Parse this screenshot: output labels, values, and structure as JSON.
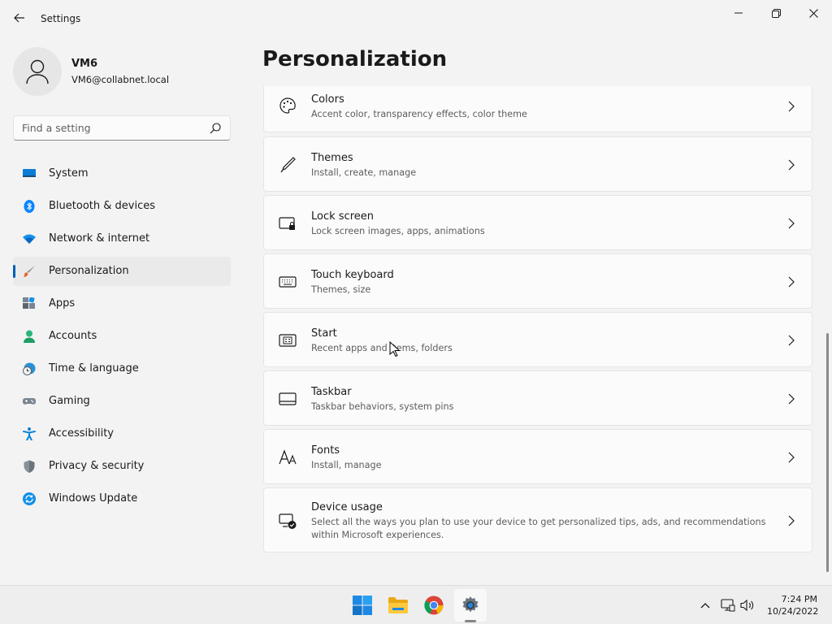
{
  "window": {
    "title": "Settings"
  },
  "profile": {
    "name": "VM6",
    "email": "VM6@collabnet.local"
  },
  "search": {
    "placeholder": "Find a setting"
  },
  "nav": {
    "items": [
      {
        "label": "System",
        "icon": "system-icon"
      },
      {
        "label": "Bluetooth & devices",
        "icon": "bluetooth-icon"
      },
      {
        "label": "Network & internet",
        "icon": "wifi-icon"
      },
      {
        "label": "Personalization",
        "icon": "brush-icon",
        "active": true
      },
      {
        "label": "Apps",
        "icon": "apps-icon"
      },
      {
        "label": "Accounts",
        "icon": "accounts-icon"
      },
      {
        "label": "Time & language",
        "icon": "clock-globe-icon"
      },
      {
        "label": "Gaming",
        "icon": "gamepad-icon"
      },
      {
        "label": "Accessibility",
        "icon": "accessibility-icon"
      },
      {
        "label": "Privacy & security",
        "icon": "shield-icon"
      },
      {
        "label": "Windows Update",
        "icon": "update-icon"
      }
    ]
  },
  "main": {
    "title": "Personalization",
    "cards": [
      {
        "title": "Colors",
        "subtitle": "Accent color, transparency effects, color theme",
        "icon": "palette-icon"
      },
      {
        "title": "Themes",
        "subtitle": "Install, create, manage",
        "icon": "pen-icon"
      },
      {
        "title": "Lock screen",
        "subtitle": "Lock screen images, apps, animations",
        "icon": "lock-screen-icon"
      },
      {
        "title": "Touch keyboard",
        "subtitle": "Themes, size",
        "icon": "keyboard-icon"
      },
      {
        "title": "Start",
        "subtitle": "Recent apps and items, folders",
        "icon": "start-icon"
      },
      {
        "title": "Taskbar",
        "subtitle": "Taskbar behaviors, system pins",
        "icon": "taskbar-icon"
      },
      {
        "title": "Fonts",
        "subtitle": "Install, manage",
        "icon": "fonts-icon"
      },
      {
        "title": "Device usage",
        "subtitle": "Select all the ways you plan to use your device to get personalized tips, ads, and recommendations within Microsoft experiences.",
        "icon": "device-usage-icon"
      }
    ]
  },
  "taskbar": {
    "apps": [
      "windows-start-icon",
      "file-explorer-icon",
      "chrome-icon",
      "settings-icon"
    ],
    "clock": {
      "time": "7:24 PM",
      "date": "10/24/2022"
    }
  },
  "colors": {
    "accent": "#005fb8",
    "background": "#f3f3f3",
    "card": "#fbfbfb"
  }
}
